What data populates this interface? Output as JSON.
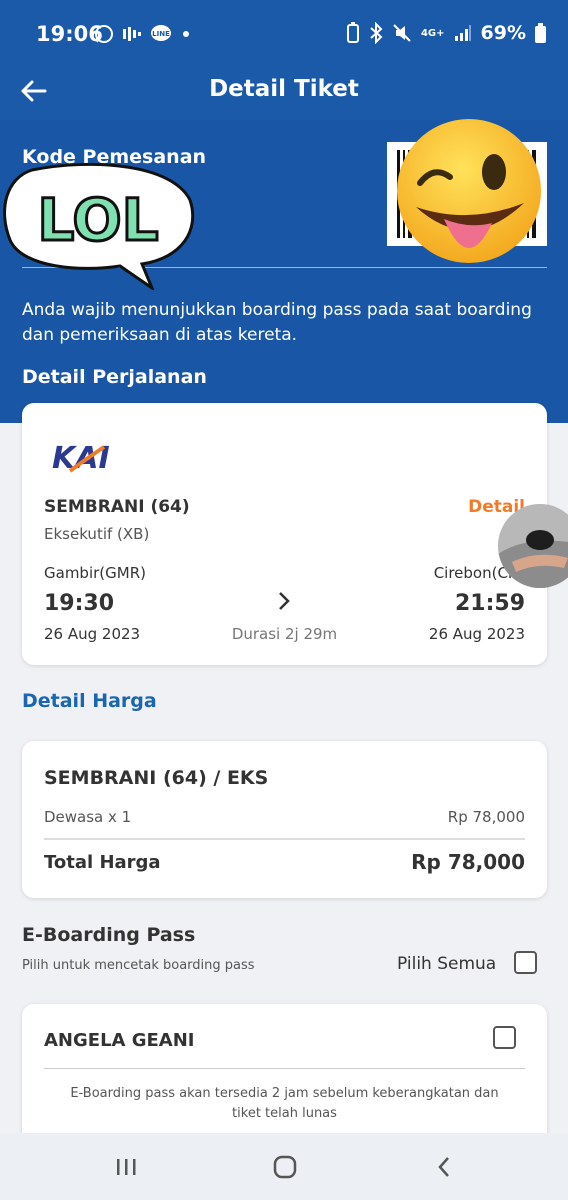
{
  "status_bar": {
    "time": "19:06",
    "network": "4G+",
    "battery": "69%"
  },
  "header": {
    "title": "Detail Tiket"
  },
  "booking": {
    "code_label": "Kode Pemesanan",
    "notice": "Anda wajib menunjukkan boarding pass pada saat boarding dan pemeriksaan di atas kereta."
  },
  "stickers": {
    "lol_text": "LOL"
  },
  "trip": {
    "section_title": "Detail Perjalanan",
    "operator_logo_text": "KAI",
    "train_name": "SEMBRANI (64)",
    "detail_link": "Detail",
    "train_class": "Eksekutif (XB)",
    "origin": "Gambir(GMR)",
    "destination": "Cirebon(CN)",
    "departure_time": "19:30",
    "arrival_time": "21:59",
    "departure_date": "26 Aug 2023",
    "arrival_date": "26 Aug 2023",
    "duration": "Durasi 2j 29m"
  },
  "price": {
    "section_title": "Detail Harga",
    "title": "SEMBRANI (64) / EKS",
    "row_label": "Dewasa x 1",
    "row_value": "Rp 78,000",
    "total_label": "Total Harga",
    "total_value": "Rp 78,000"
  },
  "eboarding": {
    "title": "E-Boarding Pass",
    "subtitle": "Pilih untuk mencetak boarding pass",
    "select_all_label": "Pilih Semua",
    "passenger_name": "ANGELA GEANI",
    "note": "E-Boarding pass akan tersedia 2 jam sebelum keberangkatan dan tiket telah lunas"
  },
  "colors": {
    "header_blue": "#1a5aa8",
    "accent_orange": "#f07c2a",
    "link_blue": "#1a66b0"
  }
}
